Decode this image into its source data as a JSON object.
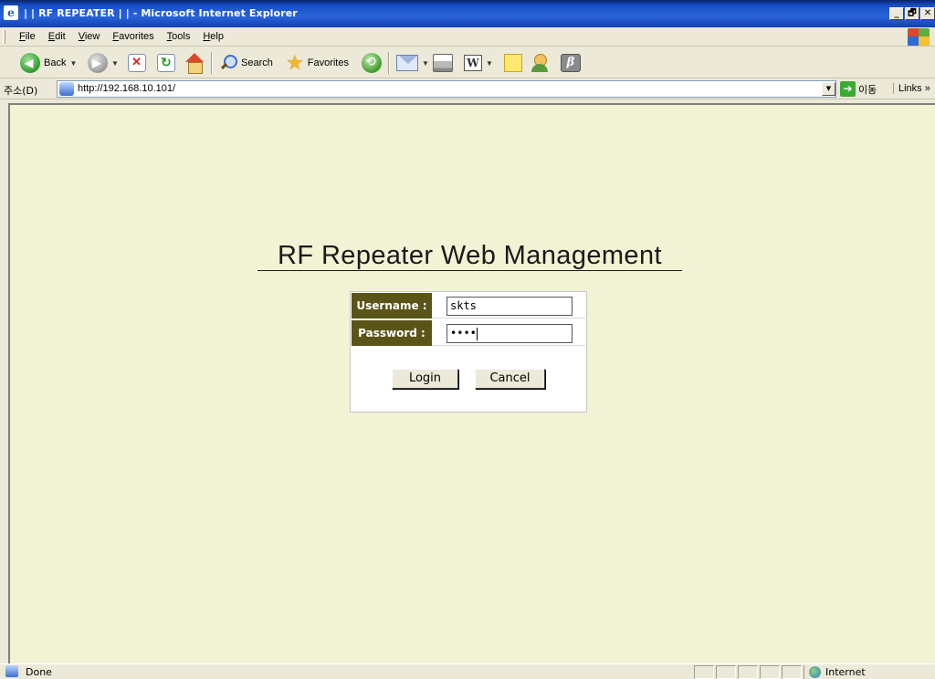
{
  "window": {
    "title": "| | RF REPEATER | | - Microsoft Internet Explorer",
    "controls": [
      "_",
      "🗗",
      "✕"
    ]
  },
  "menu": [
    "File",
    "Edit",
    "View",
    "Favorites",
    "Tools",
    "Help"
  ],
  "toolbar": {
    "back_label": "Back",
    "search_label": "Search",
    "favorites_label": "Favorites"
  },
  "address": {
    "label": "주소(D)",
    "url": "http://192.168.10.101/",
    "go_label": "이동",
    "links_label": "Links »"
  },
  "page": {
    "heading": "RF Repeater Web Management",
    "username_label": "Username :",
    "username_value": "skts",
    "password_label": "Password :",
    "password_value": "••••",
    "login_label": "Login",
    "cancel_label": "Cancel",
    "background_color": "#f2f2d4",
    "label_color": "#5a5418"
  },
  "status": {
    "text": "Done",
    "zone": "Internet"
  }
}
